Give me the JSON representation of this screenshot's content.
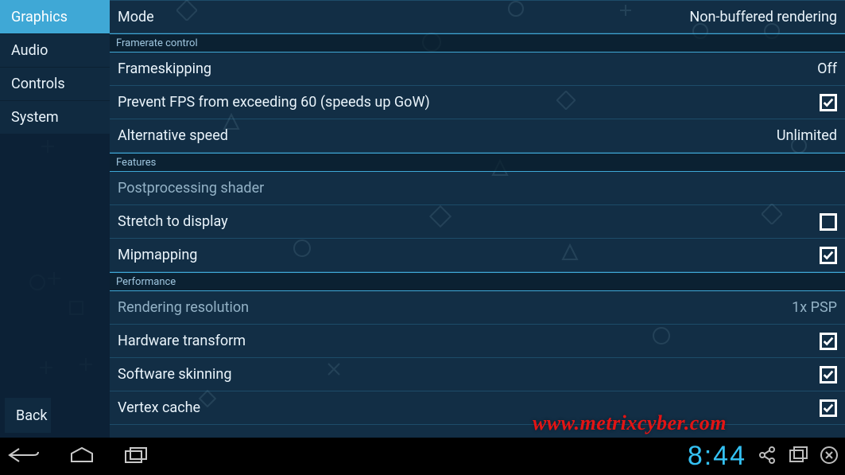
{
  "sidebar": {
    "items": [
      {
        "label": "Graphics",
        "active": true
      },
      {
        "label": "Audio",
        "active": false
      },
      {
        "label": "Controls",
        "active": false
      },
      {
        "label": "System",
        "active": false
      }
    ],
    "back_label": "Back"
  },
  "settings": {
    "top_row": {
      "label": "Mode",
      "value": "Non-buffered rendering"
    },
    "sections": [
      {
        "title": "Framerate control",
        "rows": [
          {
            "label": "Frameskipping",
            "type": "value",
            "value": "Off"
          },
          {
            "label": "Prevent FPS from exceeding 60 (speeds up GoW)",
            "type": "checkbox",
            "checked": true
          },
          {
            "label": "Alternative speed",
            "type": "value",
            "value": "Unlimited"
          }
        ]
      },
      {
        "title": "Features",
        "rows": [
          {
            "label": "Postprocessing shader",
            "type": "value",
            "value": "",
            "disabled": true
          },
          {
            "label": "Stretch to display",
            "type": "checkbox",
            "checked": false
          },
          {
            "label": "Mipmapping",
            "type": "checkbox",
            "checked": true
          }
        ]
      },
      {
        "title": "Performance",
        "rows": [
          {
            "label": "Rendering resolution",
            "type": "value",
            "value": "1x PSP",
            "disabled": true
          },
          {
            "label": "Hardware transform",
            "type": "checkbox",
            "checked": true
          },
          {
            "label": "Software skinning",
            "type": "checkbox",
            "checked": true
          },
          {
            "label": "Vertex cache",
            "type": "checkbox",
            "checked": true
          }
        ]
      }
    ]
  },
  "watermark": "www.metrixcyber.com",
  "navbar": {
    "clock": "8:44"
  }
}
